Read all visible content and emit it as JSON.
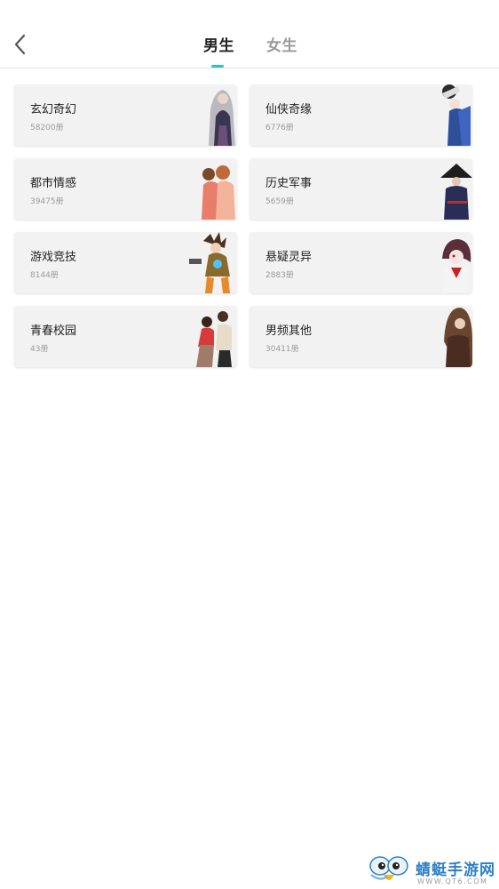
{
  "header": {
    "back_icon": "chevron-left-icon",
    "tabs": [
      {
        "label": "男生",
        "active": true
      },
      {
        "label": "女生",
        "active": false
      }
    ],
    "active_color": "#2ec4b6"
  },
  "categories": [
    {
      "name": "玄幻奇幻",
      "count": "58200册"
    },
    {
      "name": "仙侠奇缘",
      "count": "6776册"
    },
    {
      "name": "都市情感",
      "count": "39475册"
    },
    {
      "name": "历史军事",
      "count": "5659册"
    },
    {
      "name": "游戏竞技",
      "count": "8144册"
    },
    {
      "name": "悬疑灵异",
      "count": "2883册"
    },
    {
      "name": "青春校园",
      "count": "43册"
    },
    {
      "name": "男频其他",
      "count": "30411册"
    }
  ],
  "watermark": {
    "title": "蜻蜓手游网",
    "url": "WWW.QT6.COM"
  }
}
